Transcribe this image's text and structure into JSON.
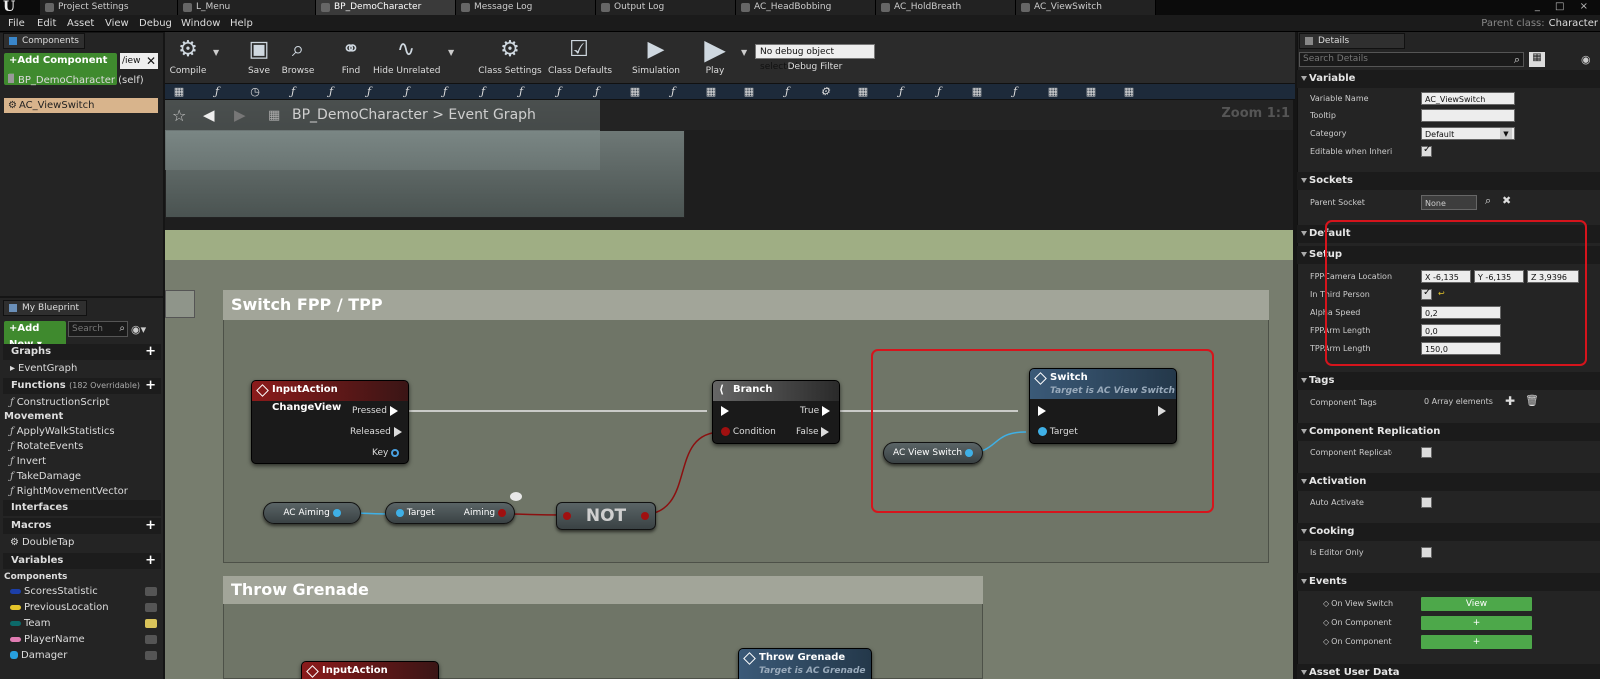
{
  "titlebar": {
    "logo": "U",
    "tabs": [
      {
        "label": "Project Settings"
      },
      {
        "label": "L_Menu"
      },
      {
        "label": "BP_DemoCharacter"
      },
      {
        "label": "Message Log"
      },
      {
        "label": "Output Log"
      },
      {
        "label": "AC_HeadBobbing"
      },
      {
        "label": "AC_HoldBreath"
      },
      {
        "label": "AC_ViewSwitch"
      }
    ],
    "window_controls": "_ □ ×"
  },
  "menubar": {
    "items": [
      "File",
      "Edit",
      "Asset",
      "View",
      "Debug",
      "Window",
      "Help"
    ],
    "parent_class_label": "Parent class:",
    "parent_class_value": "Character"
  },
  "components": {
    "tab": "Components",
    "add_button": "+Add Component ▾",
    "search_value": "/iew",
    "self_item": "BP_DemoCharacter (self)",
    "selected_item": "AC_ViewSwitch"
  },
  "my_blueprint": {
    "tab": "My Blueprint",
    "add_button": "+Add New ▾",
    "search_placeholder": "Search",
    "graphs_header": "Graphs",
    "event_graph": "EventGraph",
    "functions_header": "Functions",
    "functions_count": "(182 Overridable)",
    "construction_script": "ConstructionScript",
    "movement_header": "Movement",
    "functions": [
      "ApplyWalkStatistics",
      "RotateEvents",
      "Invert",
      "TakeDamage",
      "RightMovementVector"
    ],
    "interfaces_header": "Interfaces",
    "macros_header": "Macros",
    "macro_items": [
      "DoubleTap"
    ],
    "variables_header": "Variables",
    "components_header": "Components",
    "variables": [
      {
        "name": "ScoresStatistic",
        "color": "#1c3fa8"
      },
      {
        "name": "PreviousLocation",
        "color": "#e5c52a"
      },
      {
        "name": "Team",
        "color": "#0c6a6a"
      },
      {
        "name": "PlayerName",
        "color": "#e07cb2"
      },
      {
        "name": "Damager",
        "color": "#27a0e0"
      }
    ]
  },
  "toolbar": {
    "items": [
      {
        "label": "Compile"
      },
      {
        "label": "Save"
      },
      {
        "label": "Browse"
      },
      {
        "label": "Find"
      },
      {
        "label": "Hide Unrelated"
      },
      {
        "label": "Class Settings"
      },
      {
        "label": "Class Defaults"
      },
      {
        "label": "Simulation"
      },
      {
        "label": "Play"
      }
    ],
    "debug_select": "No debug object selected ▾",
    "debug_label": "Debug Filter"
  },
  "graph": {
    "breadcrumb_root": "BP_DemoCharacter",
    "breadcrumb_sep": ">",
    "breadcrumb_leaf": "Event Graph",
    "zoom": "Zoom 1:1",
    "comment_switch": "Switch FPP / TPP",
    "comment_grenade": "Throw Grenade",
    "input_action_changeview": {
      "title": "InputAction ChangeView",
      "pins": [
        "Pressed",
        "Released",
        "Key"
      ]
    },
    "branch": {
      "title": "Branch",
      "true_pin": "True",
      "false_pin": "False",
      "condition_pin": "Condition"
    },
    "switch_node": {
      "title": "Switch",
      "subtitle": "Target is AC View Switch",
      "target_pin": "Target"
    },
    "ac_view_switch": "AC View Switch",
    "ac_aiming": "AC Aiming",
    "aiming_getter": {
      "target_pin": "Target",
      "output_pin": "Aiming"
    },
    "not_node": "NOT",
    "input_action_grenade": "InputAction Grenade",
    "throw_grenade": {
      "title": "Throw Grenade",
      "subtitle": "Target is AC Grenade"
    }
  },
  "details": {
    "tab": "Details",
    "search_placeholder": "Search Details",
    "variable_section": "Variable",
    "variable_name_label": "Variable Name",
    "variable_name_value": "AC_ViewSwitch",
    "tooltip_label": "Tooltip",
    "tooltip_value": "",
    "category_label": "Category",
    "category_value": "Default",
    "editable_label": "Editable when Inherite",
    "sockets_section": "Sockets",
    "parent_socket_label": "Parent Socket",
    "parent_socket_value": "None",
    "default_section": "Default",
    "setup_section": "Setup",
    "fpp_camera_label": "FPPCamera Location",
    "fpp_x": "X  -6,135",
    "fpp_y": "Y  -6,135",
    "fpp_z": "Z  3,9396",
    "in_third_person_label": "In Third Person",
    "alpha_speed_label": "Alpha Speed",
    "alpha_speed_value": "0,2",
    "fpparm_label": "FPPArm Length",
    "fpparm_value": "0,0",
    "tpparm_label": "TPPArm Length",
    "tpparm_value": "150,0",
    "tags_section": "Tags",
    "component_tags_label": "Component Tags",
    "component_tags_value": "0 Array elements",
    "replication_section": "Component Replication",
    "replicates_label": "Component Replicates",
    "activation_section": "Activation",
    "auto_activate_label": "Auto Activate",
    "cooking_section": "Cooking",
    "editor_only_label": "Is Editor Only",
    "events_section": "Events",
    "on_view_switched_label": "On View Switched",
    "view_button": "View",
    "on_component_a_label": "On Component A",
    "on_component_d_label": "On Component D",
    "plus_button": "+",
    "asset_user_data_section": "Asset User Data"
  }
}
